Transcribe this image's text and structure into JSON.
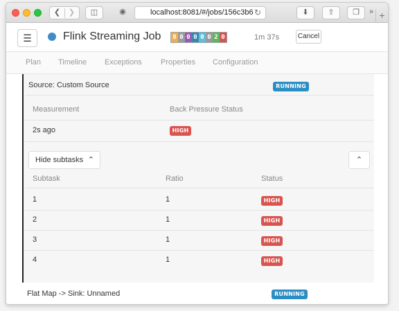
{
  "browser": {
    "url": "localhost:8081/#/jobs/156c3b6",
    "icons": [
      "back-icon",
      "forward-icon",
      "sidebar-icon",
      "privacy-icon",
      "reload-icon",
      "download-icon",
      "share-icon",
      "tabs-icon",
      "more-icon",
      "new-tab-icon"
    ]
  },
  "header": {
    "job_title": "Flink Streaming Job",
    "status_color": "#428bca",
    "counters": [
      {
        "value": "0",
        "color": "#f0ad4e"
      },
      {
        "value": "0",
        "color": "#9b9b9b"
      },
      {
        "value": "0",
        "color": "#9b59b6"
      },
      {
        "value": "0",
        "color": "#3a87ad"
      },
      {
        "value": "0",
        "color": "#5bc0de"
      },
      {
        "value": "0",
        "color": "#999999"
      },
      {
        "value": "2",
        "color": "#5cb85c"
      },
      {
        "value": "0",
        "color": "#d9534f"
      }
    ],
    "duration": "1m 37s",
    "cancel_label": "Cancel"
  },
  "tabs": [
    "Plan",
    "Timeline",
    "Exceptions",
    "Properties",
    "Configuration"
  ],
  "vertex": {
    "name": "Source: Custom Source",
    "status": "RUNNING",
    "bp_headers": {
      "measurement": "Measurement",
      "status": "Back Pressure Status"
    },
    "bp_row": {
      "measurement": "2s ago",
      "status": "HIGH"
    },
    "hide_subtasks_label": "Hide subtasks",
    "subtask_headers": {
      "subtask": "Subtask",
      "ratio": "Ratio",
      "status": "Status"
    },
    "subtasks": [
      {
        "subtask": "1",
        "ratio": "1",
        "status": "HIGH"
      },
      {
        "subtask": "2",
        "ratio": "1",
        "status": "HIGH"
      },
      {
        "subtask": "3",
        "ratio": "1",
        "status": "HIGH"
      },
      {
        "subtask": "4",
        "ratio": "1",
        "status": "HIGH"
      }
    ]
  },
  "next_vertex": {
    "name": "Flat Map -> Sink: Unnamed",
    "status": "RUNNING"
  },
  "colors": {
    "running": "#2a8dc3",
    "high": "#d9534f"
  }
}
